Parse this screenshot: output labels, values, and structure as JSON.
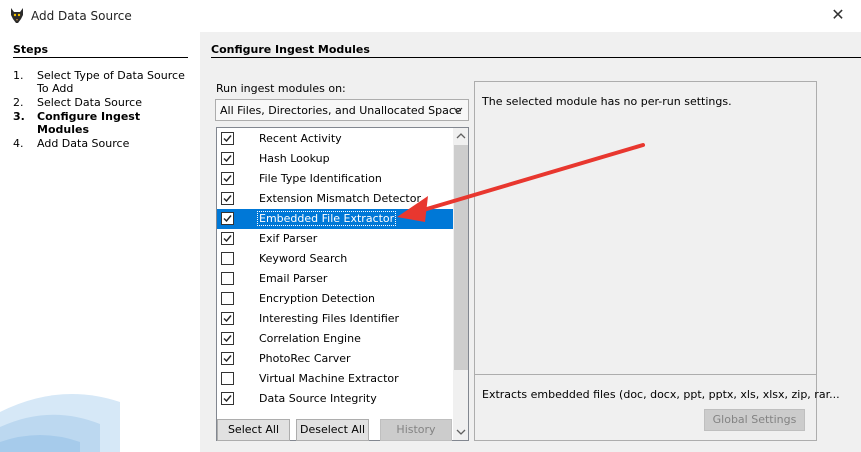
{
  "window": {
    "title": "Add Data Source",
    "close_glyph": "✕",
    "icon": "autopsy-dog-icon"
  },
  "steps": {
    "heading": "Steps",
    "items": [
      {
        "num": "1.",
        "label": "Select Type of Data Source To Add"
      },
      {
        "num": "2.",
        "label": "Select Data Source"
      },
      {
        "num": "3.",
        "label": "Configure Ingest Modules"
      },
      {
        "num": "4.",
        "label": "Add Data Source"
      }
    ],
    "current_index": 2
  },
  "main": {
    "heading": "Configure Ingest Modules",
    "run_on_label": "Run ingest modules on:",
    "run_on_value": "All Files, Directories, and Unallocated Space",
    "modules": [
      {
        "label": "Recent Activity",
        "checked": true
      },
      {
        "label": "Hash Lookup",
        "checked": true
      },
      {
        "label": "File Type Identification",
        "checked": true
      },
      {
        "label": "Extension Mismatch Detector",
        "checked": true
      },
      {
        "label": "Embedded File Extractor",
        "checked": true,
        "selected": true
      },
      {
        "label": "Exif Parser",
        "checked": true
      },
      {
        "label": "Keyword Search",
        "checked": false
      },
      {
        "label": "Email Parser",
        "checked": false
      },
      {
        "label": "Encryption Detection",
        "checked": false
      },
      {
        "label": "Interesting Files Identifier",
        "checked": true
      },
      {
        "label": "Correlation Engine",
        "checked": true
      },
      {
        "label": "PhotoRec Carver",
        "checked": true
      },
      {
        "label": "Virtual Machine Extractor",
        "checked": false
      },
      {
        "label": "Data Source Integrity",
        "checked": true
      }
    ],
    "buttons": {
      "select_all": "Select All",
      "deselect_all": "Deselect All",
      "history": "History"
    }
  },
  "settings": {
    "message": "The selected module has no per-run settings.",
    "description": "Extracts embedded files (doc, docx, ppt, pptx, xls, xlsx, zip, rar...",
    "global_button": "Global Settings"
  },
  "colors": {
    "selection": "#0078d7",
    "annotation_arrow": "#e8372f"
  }
}
